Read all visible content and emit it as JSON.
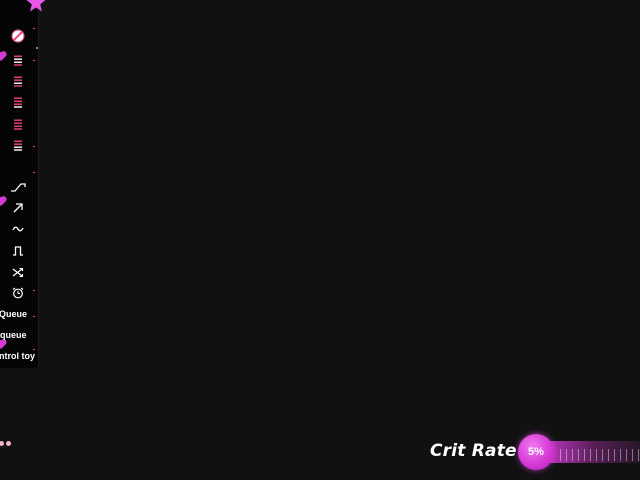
{
  "sidebar": {
    "icons": [
      {
        "name": "block-icon"
      },
      {
        "name": "list-icon"
      },
      {
        "name": "list-icon"
      },
      {
        "name": "list-icon"
      },
      {
        "name": "list-icon"
      },
      {
        "name": "list-icon"
      },
      {
        "name": "ramp-icon"
      },
      {
        "name": "arrow-up-right-icon"
      },
      {
        "name": "wave-icon"
      },
      {
        "name": "pulse-icon"
      },
      {
        "name": "shuffle-icon"
      },
      {
        "name": "alarm-clock-icon"
      }
    ],
    "queue_label": "Queue",
    "queue_label_2": "queue",
    "control_toy_label": "ntrol toy"
  },
  "crit": {
    "label": "Crit Rate",
    "value_text": "5%",
    "percent": 5
  },
  "colors": {
    "background": "#111111",
    "accent": "#d63ad6",
    "icon_pink": "#f0447f",
    "tick_pink": "#e0409a"
  }
}
